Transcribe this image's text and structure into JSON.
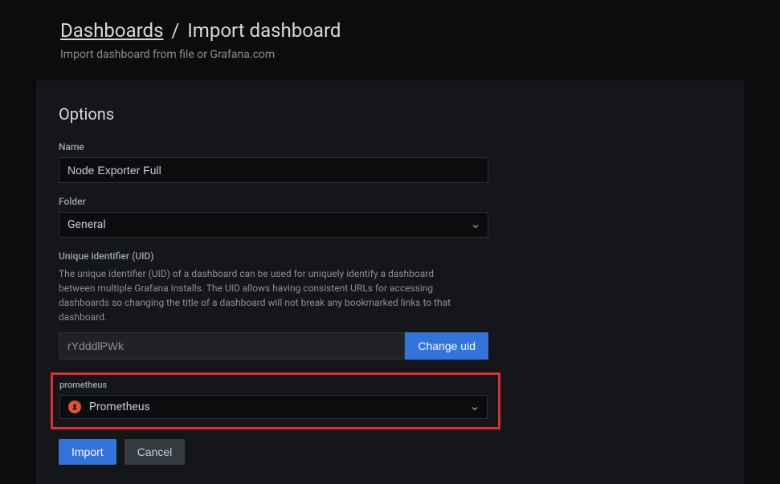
{
  "breadcrumb": {
    "root": "Dashboards",
    "current": "Import dashboard"
  },
  "subtitle": "Import dashboard from file or Grafana.com",
  "options": {
    "title": "Options",
    "name": {
      "label": "Name",
      "value": "Node Exporter Full"
    },
    "folder": {
      "label": "Folder",
      "value": "General"
    },
    "uid": {
      "label": "Unique identifier (UID)",
      "help": "The unique identifier (UID) of a dashboard can be used for uniquely identify a dashboard between multiple Grafana installs. The UID allows having consistent URLs for accessing dashboards so changing the title of a dashboard will not break any bookmarked links to that dashboard.",
      "value": "rYdddlPWk",
      "change_label": "Change uid"
    },
    "datasource": {
      "label": "prometheus",
      "value": "Prometheus"
    }
  },
  "buttons": {
    "import": "Import",
    "cancel": "Cancel"
  }
}
